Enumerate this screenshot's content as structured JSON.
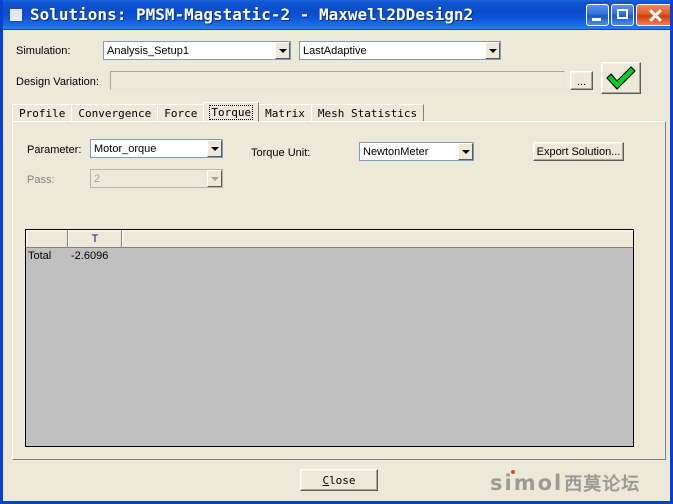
{
  "window": {
    "title": "Solutions: PMSM-Magstatic-2 - Maxwell2DDesign2",
    "icon": "window-icon",
    "minimize_label": "_",
    "maximize_label": "[]",
    "close_label": "X",
    "titlebar_color": "#0a4ccc",
    "face_color": "#ece9d8"
  },
  "top": {
    "simulation_label": "Simulation:",
    "simulation_value": "Analysis_Setup1",
    "adaptive_value": "LastAdaptive",
    "design_variation_label": "Design Variation:",
    "design_variation_value": "",
    "browse_label": "...",
    "validate_icon": "green-check-icon",
    "validate_color": "#00d21e"
  },
  "tabs": [
    {
      "label": "Profile",
      "selected": false
    },
    {
      "label": "Convergence",
      "selected": false
    },
    {
      "label": "Force",
      "selected": false
    },
    {
      "label": "Torque",
      "selected": true
    },
    {
      "label": "Matrix",
      "selected": false
    },
    {
      "label": "Mesh Statistics",
      "selected": false
    }
  ],
  "panel": {
    "parameter_label": "Parameter:",
    "parameter_value": "Motor_orque",
    "pass_label": "Pass:",
    "pass_value": "2",
    "pass_disabled": true,
    "torque_unit_label": "Torque Unit:",
    "torque_unit_value": "NewtonMeter",
    "export_label": "Export Solution..."
  },
  "grid": {
    "columns": [
      "",
      "T",
      ""
    ],
    "header_text_color": "#33006b",
    "rows": [
      {
        "name": "Total",
        "t": "-2.6096",
        "extra": ""
      }
    ]
  },
  "footer": {
    "close_label": "Close",
    "close_accel": "C",
    "watermark_latin": "simol",
    "watermark_cjk": "西莫论坛"
  }
}
